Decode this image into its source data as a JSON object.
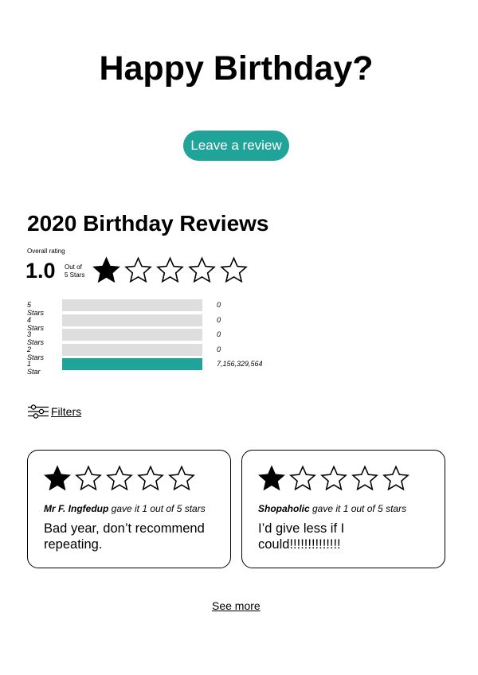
{
  "page": {
    "title": "Happy Birthday?"
  },
  "review_button": {
    "label": "Leave a review"
  },
  "reviews_section": {
    "title": "2020 Birthday Reviews",
    "overall_label": "Overall rating",
    "overall_value": "1.0",
    "out_of_line1": "Out of",
    "out_of_line2": "5 Stars",
    "overall_stars_filled": 1,
    "overall_stars_total": 5
  },
  "distribution": [
    {
      "label": "5 Stars",
      "count": "0",
      "fraction": 0
    },
    {
      "label": "4 Stars",
      "count": "0",
      "fraction": 0
    },
    {
      "label": "3 Stars",
      "count": "0",
      "fraction": 0
    },
    {
      "label": "2 Stars",
      "count": "0",
      "fraction": 0
    },
    {
      "label": "1 Star",
      "count": "7,156,329,564",
      "fraction": 1
    }
  ],
  "filters": {
    "label": "Filters",
    "icon": "filter-sliders-icon"
  },
  "reviews": [
    {
      "stars_filled": 1,
      "stars_total": 5,
      "reviewer": "Mr F. Ingfedup",
      "meta_suffix": " gave it 1 out of 5 stars",
      "text": "Bad year, don’t recommend repeating."
    },
    {
      "stars_filled": 1,
      "stars_total": 5,
      "reviewer": "Shopaholic",
      "meta_suffix": " gave it 1 out of 5 stars",
      "text": "I’d give less if I could!!!!!!!!!!!!!!"
    }
  ],
  "see_more": {
    "label": "See more"
  },
  "colors": {
    "accent": "#20a398",
    "bar_empty": "#dedede",
    "text": "#000000"
  }
}
